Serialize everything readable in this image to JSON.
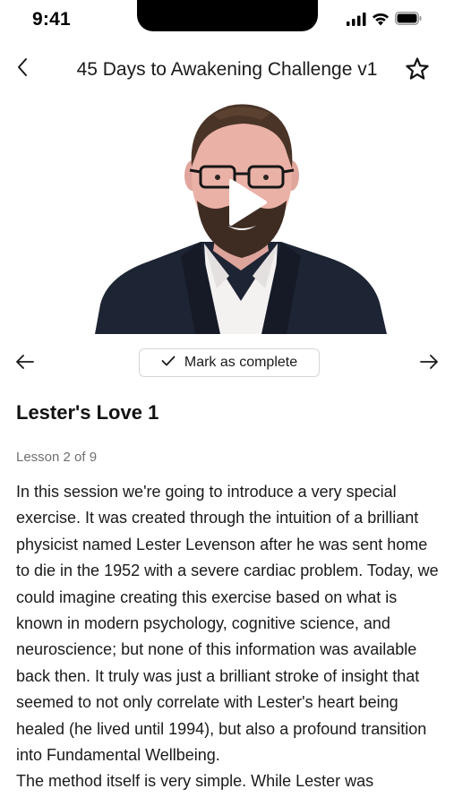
{
  "status_bar": {
    "time": "9:41",
    "icons": [
      "signal-icon",
      "wifi-icon",
      "battery-icon"
    ]
  },
  "header": {
    "title": "45 Days to Awakening Challenge v1",
    "back_icon": "chevron-left-icon",
    "favorite_icon": "star-outline-icon"
  },
  "video": {
    "play_icon": "play-icon"
  },
  "controls": {
    "prev_icon": "arrow-left-icon",
    "next_icon": "arrow-right-icon",
    "complete_icon": "check-icon",
    "complete_label": "Mark as complete"
  },
  "lesson": {
    "title": "Lester's Love 1",
    "count": "Lesson 2 of 9",
    "paragraphs": [
      "In this session we're going to introduce a very special exercise. It was created through the intuition of a brilliant physicist named Lester Levenson after he was sent home to die in the 1952 with a severe cardiac problem. Today, we could imagine creating this exercise based on what is known in modern psychology, cognitive science, and neuroscience; but none of this information was available back then. It truly was just a brilliant stroke of insight that seemed to not only correlate with Lester's heart being healed (he lived until 1994), but also a profound transition into Fundamental Wellbeing.",
      "The method itself is very simple. While Lester was"
    ]
  },
  "colors": {
    "text": "#1a1a1a",
    "muted": "#6f6f6f",
    "border": "#d6d6d6",
    "background": "#ffffff"
  }
}
